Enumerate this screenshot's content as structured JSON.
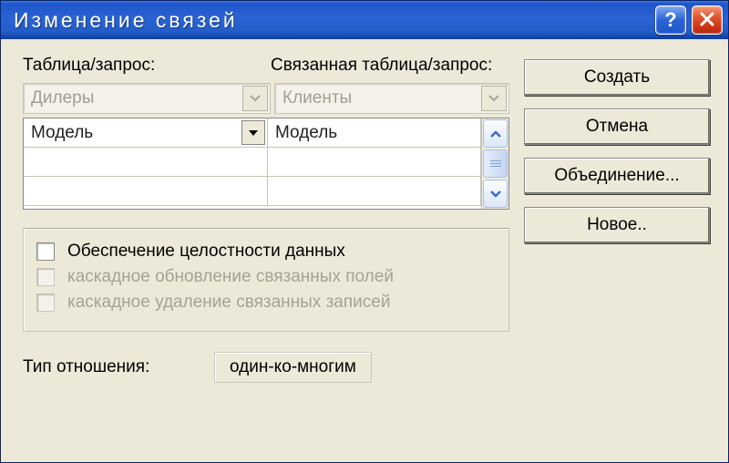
{
  "window": {
    "title": "Изменение связей"
  },
  "labels": {
    "table_query": "Таблица/запрос:",
    "related_table_query": "Связанная таблица/запрос:"
  },
  "combos": {
    "left_value": "Дилеры",
    "right_value": "Клиенты"
  },
  "grid": {
    "left_field": "Модель",
    "right_field": "Модель"
  },
  "checkboxes": {
    "integrity": "Обеспечение целостности данных",
    "cascade_update": "каскадное обновление связанных полей",
    "cascade_delete": "каскадное удаление связанных записей"
  },
  "relation": {
    "label": "Тип отношения:",
    "value": "один-ко-многим"
  },
  "buttons": {
    "create": "Создать",
    "cancel": "Отмена",
    "join": "Объединение...",
    "new": "Новое.."
  }
}
